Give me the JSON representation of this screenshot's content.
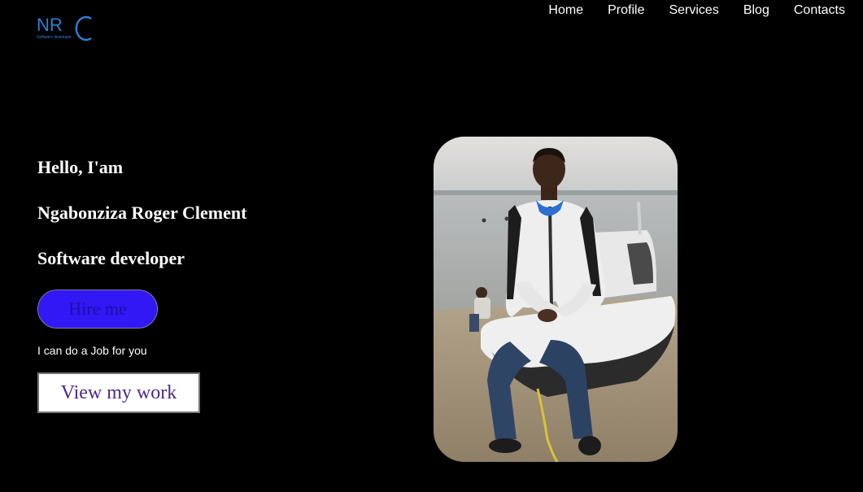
{
  "logo": {
    "letters": "NRC",
    "subtitle": "Software developer",
    "color": "#2f7fd0"
  },
  "nav": {
    "items": [
      {
        "label": "Home"
      },
      {
        "label": "Profile"
      },
      {
        "label": "Services"
      },
      {
        "label": "Blog"
      },
      {
        "label": "Contacts"
      }
    ]
  },
  "hero": {
    "greeting": "Hello, I'am",
    "name": "Ngabonziza Roger Clement",
    "role": "Software developer",
    "hire_label": "Hire me",
    "tagline": "I can do a Job for you",
    "work_label": "View my work"
  },
  "colors": {
    "background": "#000000",
    "hire_button": "#3218f4",
    "hire_text": "#1a0fa8",
    "work_text": "#4b2a8a"
  }
}
